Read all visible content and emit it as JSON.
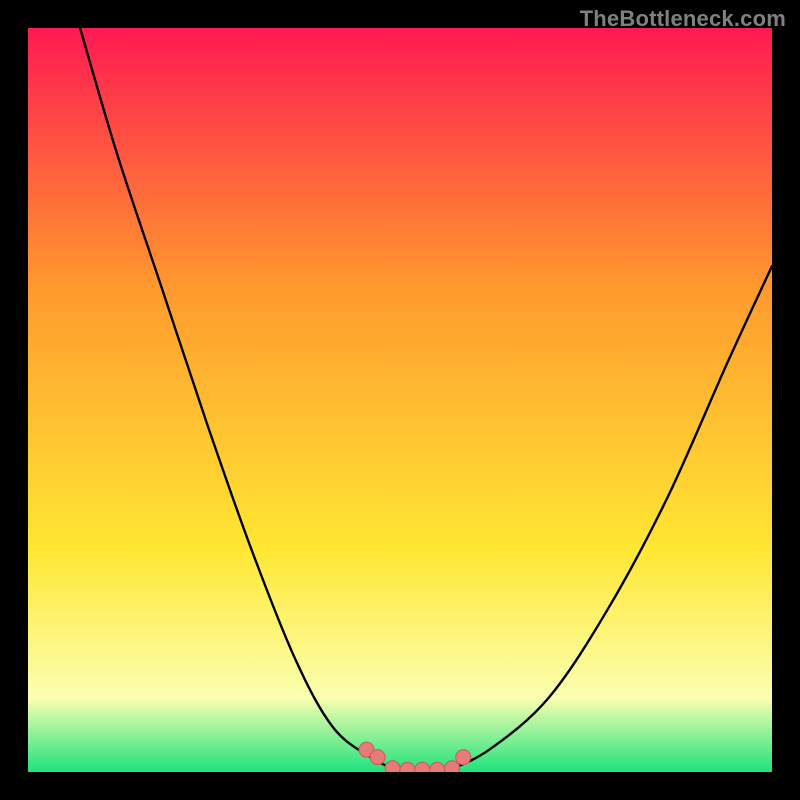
{
  "watermark": "TheBottleneck.com",
  "colors": {
    "frame": "#000000",
    "grad_top": "#ff1a52",
    "grad_mid1": "#ff9a2e",
    "grad_mid2": "#ffe733",
    "grad_low": "#fbffb0",
    "grad_bottom": "#1fe27e",
    "curve": "#000000",
    "marker_fill": "#e77b79",
    "marker_stroke": "#c95a58"
  },
  "chart_data": {
    "type": "line",
    "title": "",
    "xlabel": "",
    "ylabel": "",
    "xlim": [
      0,
      1
    ],
    "ylim": [
      0,
      1
    ],
    "series": [
      {
        "name": "left-branch",
        "x": [
          0.07,
          0.12,
          0.18,
          0.24,
          0.3,
          0.36,
          0.41,
          0.46,
          0.49,
          0.5
        ],
        "values": [
          1.0,
          0.83,
          0.65,
          0.47,
          0.3,
          0.15,
          0.06,
          0.02,
          0.005,
          0.0
        ]
      },
      {
        "name": "right-branch",
        "x": [
          0.56,
          0.62,
          0.7,
          0.78,
          0.86,
          0.94,
          1.0
        ],
        "values": [
          0.0,
          0.03,
          0.1,
          0.22,
          0.37,
          0.55,
          0.68
        ]
      }
    ],
    "markers": {
      "name": "bottom-dots",
      "x": [
        0.455,
        0.47,
        0.49,
        0.51,
        0.53,
        0.55,
        0.57,
        0.585
      ],
      "y": [
        0.03,
        0.02,
        0.005,
        0.003,
        0.003,
        0.003,
        0.005,
        0.02
      ]
    },
    "gradient_stops": [
      {
        "offset": 0.0,
        "color": "#ff1a52"
      },
      {
        "offset": 0.35,
        "color": "#ff9a2e"
      },
      {
        "offset": 0.7,
        "color": "#ffe733"
      },
      {
        "offset": 0.9,
        "color": "#fbffb0"
      },
      {
        "offset": 1.0,
        "color": "#1fe27e"
      }
    ]
  }
}
